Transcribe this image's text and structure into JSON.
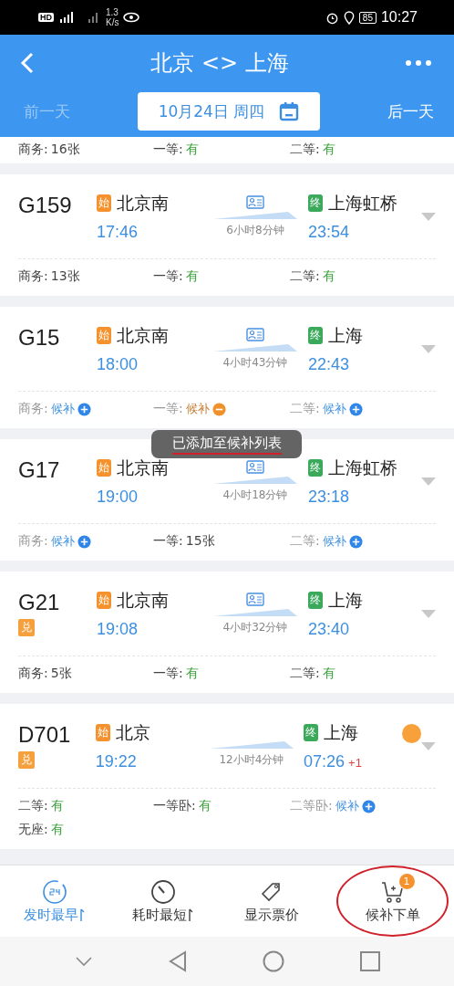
{
  "status_bar": {
    "hd": "HD",
    "speed": "1.3",
    "speed_unit": "K/s",
    "battery": "85",
    "time": "10:27"
  },
  "header": {
    "title": "北京 <> 上海",
    "prev_day": {
      "label": "前一天",
      "disabled": true
    },
    "date": "10月24日 周四",
    "next_day": {
      "label": "后一天",
      "disabled": false
    }
  },
  "partial_row": {
    "seats": [
      {
        "label": "商务:",
        "value": "16张",
        "kind": "count"
      },
      {
        "label": "一等:",
        "value": "有",
        "kind": "available"
      },
      {
        "label": "二等:",
        "value": "有",
        "kind": "available"
      }
    ]
  },
  "trains": [
    {
      "number": "G159",
      "from_tag": "始",
      "from": "北京南",
      "depart": "17:46",
      "duration": "6小时8分钟",
      "id_icon": true,
      "to_tag": "终",
      "to": "上海虹桥",
      "arrive": "23:54",
      "marker": false,
      "seats": [
        {
          "label": "商务:",
          "value": "13张",
          "kind": "count"
        },
        {
          "label": "一等:",
          "value": "有",
          "kind": "available"
        },
        {
          "label": "二等:",
          "value": "有",
          "kind": "available"
        }
      ]
    },
    {
      "number": "G15",
      "from_tag": "始",
      "from": "北京南",
      "depart": "18:00",
      "duration": "4小时43分钟",
      "id_icon": true,
      "to_tag": "终",
      "to": "上海",
      "arrive": "22:43",
      "marker": false,
      "seats": [
        {
          "label": "商务:",
          "value": "候补",
          "kind": "waitlist"
        },
        {
          "label": "一等:",
          "value": "候补",
          "kind": "waitlist_added"
        },
        {
          "label": "二等:",
          "value": "候补",
          "kind": "waitlist"
        }
      ]
    },
    {
      "number": "G17",
      "from_tag": "始",
      "from": "北京南",
      "depart": "19:00",
      "duration": "4小时18分钟",
      "id_icon": true,
      "to_tag": "终",
      "to": "上海虹桥",
      "arrive": "23:18",
      "marker": false,
      "seats": [
        {
          "label": "商务:",
          "value": "候补",
          "kind": "waitlist"
        },
        {
          "label": "一等:",
          "value": "15张",
          "kind": "count"
        },
        {
          "label": "二等:",
          "value": "候补",
          "kind": "waitlist"
        }
      ]
    },
    {
      "number": "G21",
      "badge": "兑",
      "from_tag": "始",
      "from": "北京南",
      "depart": "19:08",
      "duration": "4小时32分钟",
      "id_icon": true,
      "to_tag": "终",
      "to": "上海",
      "arrive": "23:40",
      "marker": false,
      "seats": [
        {
          "label": "商务:",
          "value": "5张",
          "kind": "count"
        },
        {
          "label": "一等:",
          "value": "有",
          "kind": "available"
        },
        {
          "label": "二等:",
          "value": "有",
          "kind": "available"
        }
      ]
    },
    {
      "number": "D701",
      "badge": "兑",
      "from_tag": "始",
      "from": "北京",
      "depart": "19:22",
      "duration": "12小时4分钟",
      "id_icon": false,
      "to_tag": "终",
      "to": "上海",
      "arrive": "07:26",
      "day_offset": "+1",
      "marker": true,
      "seats": [
        {
          "label": "二等:",
          "value": "有",
          "kind": "available"
        },
        {
          "label": "一等卧:",
          "value": "有",
          "kind": "available"
        },
        {
          "label": "二等卧:",
          "value": "候补",
          "kind": "waitlist"
        },
        {
          "label": "无座:",
          "value": "有",
          "kind": "available"
        }
      ]
    }
  ],
  "toast": {
    "text": "已添加至候补列表",
    "underlined": true
  },
  "bottom_tabs": [
    {
      "kind": "clock24",
      "label": "发时最早",
      "selected": true,
      "sort": true,
      "circled": false
    },
    {
      "kind": "timer",
      "label": "耗时最短",
      "selected": false,
      "sort": true,
      "circled": false
    },
    {
      "kind": "tag",
      "label": "显示票价",
      "selected": false,
      "sort": false,
      "circled": false
    },
    {
      "kind": "cart",
      "label": "候补下单",
      "selected": false,
      "sort": false,
      "count": "1",
      "circled": true
    }
  ]
}
